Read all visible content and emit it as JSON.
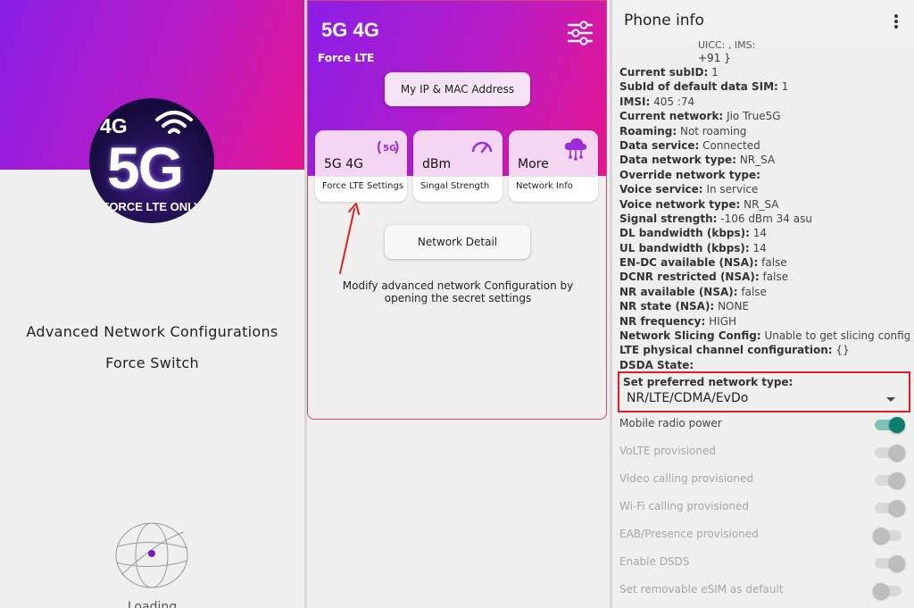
{
  "splash": {
    "logo_top": "4G",
    "logo_main": "5G",
    "logo_bottom": "FORCE LTE ONLY",
    "line1": "Advanced Network Configurations",
    "line2": "Force Switch",
    "loading": "Loading"
  },
  "app": {
    "title": "5G 4G",
    "subtitle": "Force LTE",
    "ip_button": "My IP & MAC Address",
    "tiles": [
      {
        "label": "5G 4G",
        "caption": "Force LTE Settings",
        "icon": "5g-signal-icon"
      },
      {
        "label": "dBm",
        "caption": "Singal Strength",
        "icon": "speedometer-icon"
      },
      {
        "label": "More",
        "caption": "Network Info",
        "icon": "cloud-network-icon"
      }
    ],
    "detail_button": "Network Detail",
    "modify_text": "Modify advanced network Configuration by opening the secret settings"
  },
  "phone_info": {
    "title": "Phone info",
    "trunc_line1": "UICC: , IMS:",
    "trunc_line2": "+91 }",
    "rows": [
      {
        "key": "Current subID:",
        "value": "1"
      },
      {
        "key": "SubId of default data SIM:",
        "value": "1"
      },
      {
        "key": "IMSI:",
        "value": "405 :74"
      },
      {
        "key": "Current network:",
        "value": "Jio True5G"
      },
      {
        "key": "Roaming:",
        "value": "Not roaming"
      },
      {
        "key": "Data service:",
        "value": "Connected"
      },
      {
        "key": "Data network type:",
        "value": "NR_SA"
      },
      {
        "key": "Override network type:",
        "value": ""
      },
      {
        "key": "Voice service:",
        "value": "In service"
      },
      {
        "key": "Voice network type:",
        "value": "NR_SA"
      },
      {
        "key": "Signal strength:",
        "value": "-106 dBm   34 asu"
      },
      {
        "key": "DL bandwidth (kbps):",
        "value": "14"
      },
      {
        "key": "UL bandwidth (kbps):",
        "value": "14"
      },
      {
        "key": "EN-DC available (NSA):",
        "value": "false"
      },
      {
        "key": "DCNR restricted (NSA):",
        "value": "false"
      },
      {
        "key": "NR available (NSA):",
        "value": "false"
      },
      {
        "key": "NR state (NSA):",
        "value": "NONE"
      },
      {
        "key": "NR frequency:",
        "value": "HIGH"
      },
      {
        "key": "Network Slicing Config:",
        "value": "Unable to get slicing config."
      },
      {
        "key": "LTE physical channel configuration:",
        "value": "{}"
      },
      {
        "key": "DSDA State:",
        "value": ""
      }
    ],
    "preferred_label": "Set preferred network type:",
    "preferred_value": "NR/LTE/CDMA/EvDo",
    "toggles": [
      {
        "label": "Mobile radio power",
        "on": true,
        "enabled": true
      },
      {
        "label": "VoLTE provisioned",
        "on": true,
        "enabled": false
      },
      {
        "label": "Video calling provisioned",
        "on": true,
        "enabled": false
      },
      {
        "label": "Wi-Fi calling provisioned",
        "on": true,
        "enabled": false
      },
      {
        "label": "EAB/Presence provisioned",
        "on": false,
        "enabled": false
      },
      {
        "label": "Enable DSDS",
        "on": true,
        "enabled": false
      },
      {
        "label": "Set removable eSIM as default",
        "on": false,
        "enabled": false
      }
    ]
  },
  "colors": {
    "gradient_start": "#8a1ee6",
    "gradient_end": "#e6158f",
    "tile_top": "#f4d6f3",
    "highlight_red": "#e02020",
    "toggle_on": "#0f7f6d",
    "toggle_on_track": "#7fc2b6",
    "toggle_disabled": "#bdbdbd",
    "arrow_red": "#e02020"
  }
}
